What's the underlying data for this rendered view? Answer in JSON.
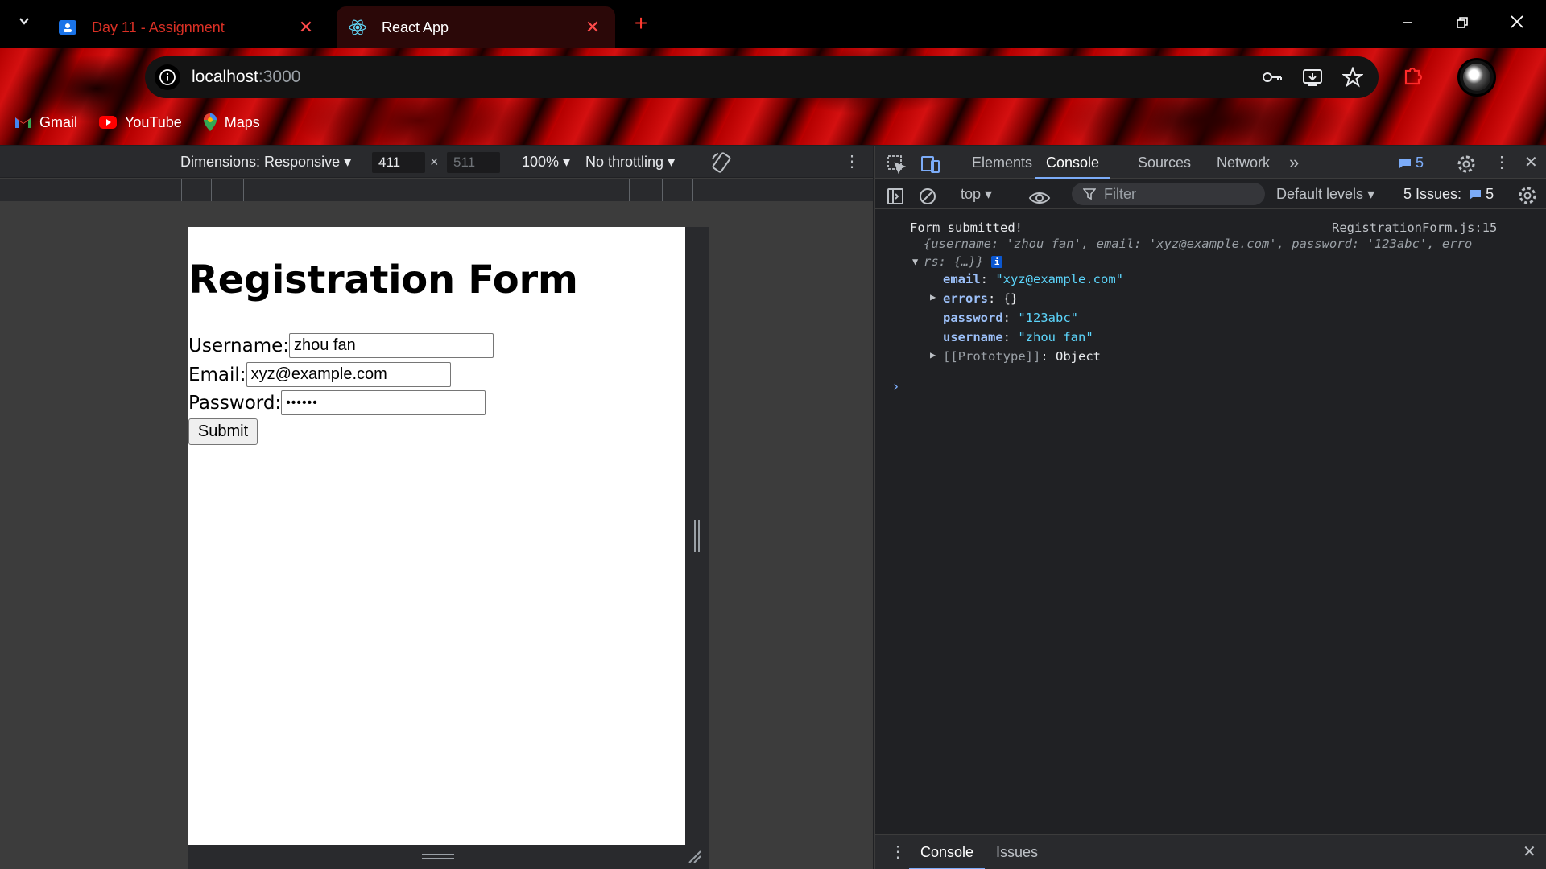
{
  "tabs": [
    {
      "title": "Day 11 - Assignment",
      "state": "inactive"
    },
    {
      "title": "React App",
      "state": "active"
    }
  ],
  "address": {
    "host": "localhost",
    "port": ":3000"
  },
  "bookmarks": [
    {
      "label": "Gmail"
    },
    {
      "label": "YouTube"
    },
    {
      "label": "Maps"
    }
  ],
  "device_toolbar": {
    "dimensions_label": "Dimensions: Responsive",
    "width": "411",
    "times": "×",
    "height": "511",
    "zoom": "100%",
    "throttling": "No throttling"
  },
  "page": {
    "heading": "Registration Form",
    "username_label": "Username:",
    "username_value": "zhou fan",
    "email_label": "Email:",
    "email_value": "xyz@example.com",
    "password_label": "Password:",
    "password_masked": "••••••",
    "submit_label": "Submit"
  },
  "devtools": {
    "tabs": [
      "Elements",
      "Console",
      "Sources",
      "Network"
    ],
    "active_tab": "Console",
    "message_count": "5",
    "context": "top",
    "filter_placeholder": "Filter",
    "levels": "Default levels",
    "issues_label": "5 Issues:",
    "issues_count": "5",
    "drawer_tabs": [
      "Console",
      "Issues"
    ]
  },
  "console": {
    "message": "Form submitted!",
    "source_link": "RegistrationForm.js:15",
    "preview_line1": "{username: 'zhou fan', email: 'xyz@example.com', password: '123abc', erro",
    "preview_line2": "rs: {…}}",
    "props": [
      {
        "key": "email",
        "value": "\"xyz@example.com\""
      },
      {
        "key": "errors",
        "value": "{}"
      },
      {
        "key": "password",
        "value": "\"123abc\""
      },
      {
        "key": "username",
        "value": "\"zhou fan\""
      },
      {
        "key": "[[Prototype]]",
        "value": "Object"
      }
    ]
  },
  "colors": {
    "accent": "#7cacf8",
    "theme": "#c00000",
    "tab_close": "#ff4b4b"
  }
}
